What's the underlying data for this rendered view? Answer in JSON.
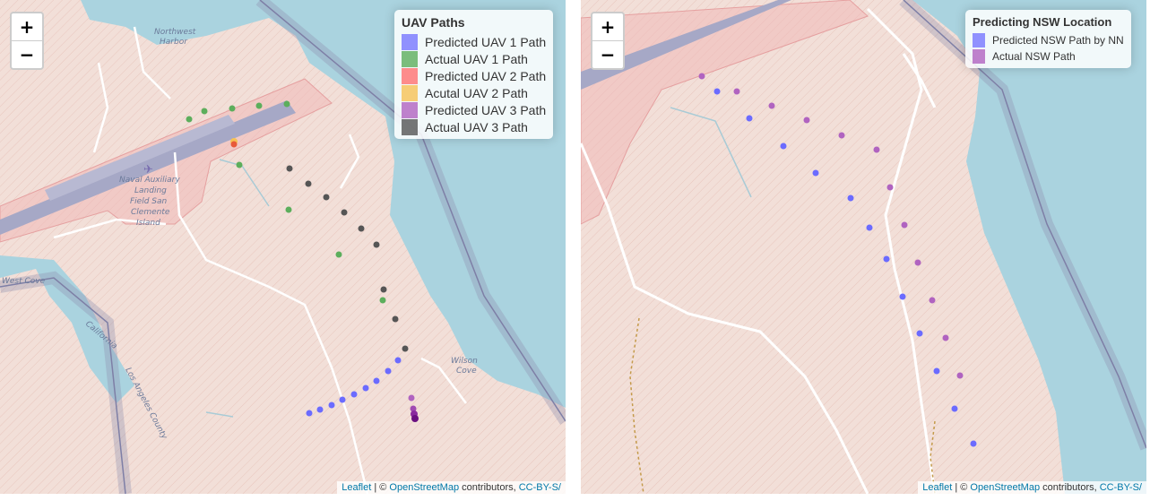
{
  "zoom_controls": {
    "zoom_in_label": "+",
    "zoom_out_label": "−"
  },
  "left_map": {
    "legend": {
      "title": "UAV Paths",
      "items": [
        {
          "label": "Predicted UAV 1 Path",
          "color": "#7777ff"
        },
        {
          "label": "Actual UAV 1 Path",
          "color": "#5cae5c"
        },
        {
          "label": "Predicted UAV 2 Path",
          "color": "#ff7070"
        },
        {
          "label": "Acutal UAV 2 Path",
          "color": "#f6c255"
        },
        {
          "label": "Predicted UAV 3 Path",
          "color": "#b063c0"
        },
        {
          "label": "Actual UAV 3 Path",
          "color": "#555555"
        }
      ]
    },
    "labels": {
      "northwest_harbor": [
        "Northwest",
        "Harbor"
      ],
      "airfield": [
        "Naval Auxiliary",
        "Landing",
        "Field San",
        "Clemente",
        "Island"
      ],
      "west_cove": "West Cove",
      "california": "California",
      "los_angeles_county": "Los Angeles County",
      "wilson_cove": [
        "Wilson",
        "Cove"
      ]
    }
  },
  "right_map": {
    "legend": {
      "title": "Predicting NSW Location",
      "items": [
        {
          "label": "Predicted NSW Path by NN",
          "color": "#7777ff"
        },
        {
          "label": "Actual NSW Path",
          "color": "#b063c0"
        }
      ]
    }
  },
  "attribution": {
    "leaflet": "Leaflet",
    "separator": " | © ",
    "osm": "OpenStreetMap",
    "contributors": " contributors, ",
    "license": "CC-BY-S/"
  }
}
